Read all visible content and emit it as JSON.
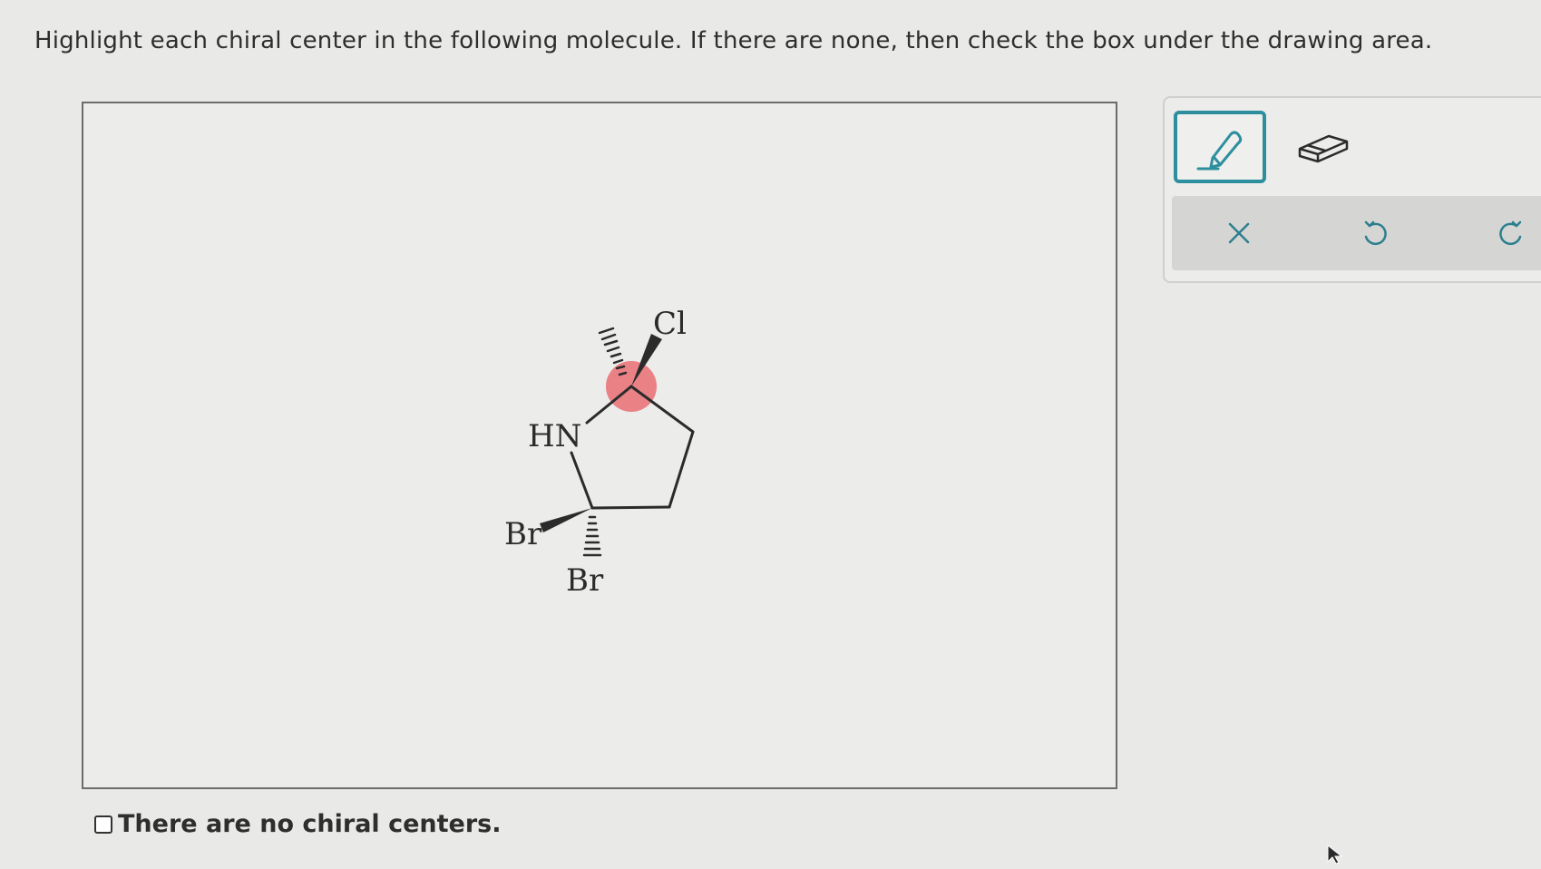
{
  "question": {
    "text": "Highlight each chiral center in the following molecule. If there are none, then check the box under the drawing area."
  },
  "molecule": {
    "atoms": {
      "cl": "Cl",
      "hn": "HN",
      "br_left": "Br",
      "br_bottom": "Br"
    },
    "highlight_color": "#e8545a"
  },
  "no_chiral_option": {
    "label": "There are no chiral centers.",
    "checked": false
  },
  "toolbar": {
    "tools": [
      "pencil-icon",
      "eraser-icon"
    ],
    "actions": [
      "close-icon",
      "undo-icon",
      "redo-icon"
    ],
    "selected_tool": "pencil",
    "accent_color": "#2d8f9e"
  }
}
